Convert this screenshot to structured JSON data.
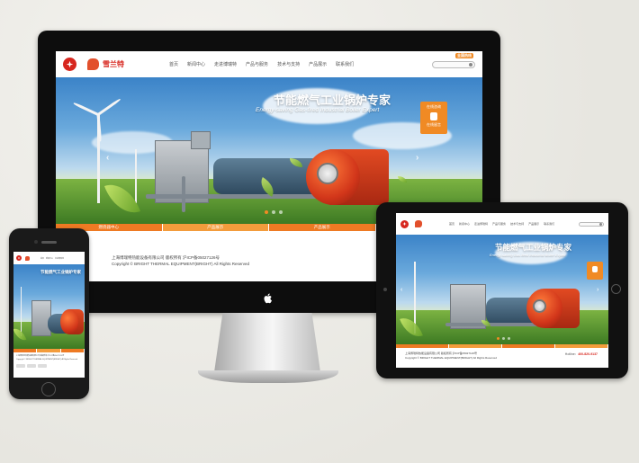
{
  "site": {
    "company_cn": "上海锅炉热能设备有限公司",
    "logo_brand": "雪兰特",
    "nav": [
      "首页",
      "新闻中心",
      "走进博瑞特",
      "产品与服务",
      "技术与支持",
      "产品展示",
      "联系我们"
    ],
    "search_placeholder": "",
    "hotline_tag": "全国热线",
    "hero_title": "节能燃气工业锅炉专家",
    "hero_subtitle": "Energy-saving Gas-fired Industrial Boiler Expert",
    "side_widget": {
      "top": "在线咨询",
      "bottom": "在线留言"
    },
    "tabs": [
      "燃烧器中心",
      "产品展示",
      "产品展示",
      "新闻动态"
    ],
    "footer_line1": "上海博瑞特热能设备有限公司  版权所有  沪ICP备05027126号",
    "footer_line2": "Copyright © BRIGHT THERMAL EQUIPMENT(BRIGHT) All Rights Reserved",
    "footer_right": "节能燃气",
    "hotline_label": "Hotline：",
    "hotline_number": "400-820-9137"
  },
  "colors": {
    "accent_orange": "#f08a24",
    "brand_red": "#d7261e",
    "device_black": "#0d0d0d"
  },
  "icons": [
    "apple-logo-icon",
    "search-icon",
    "chat-icon",
    "home-button-icon"
  ]
}
